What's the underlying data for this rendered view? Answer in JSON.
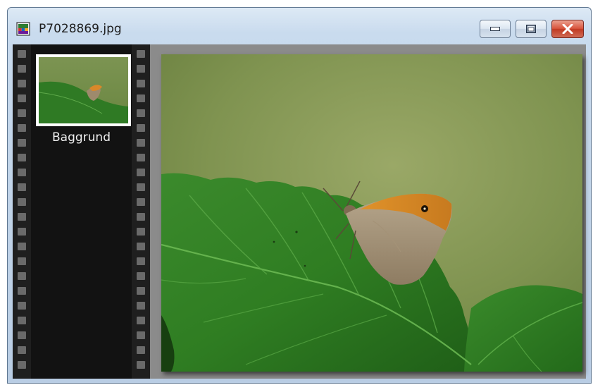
{
  "window": {
    "title": "P7028869.jpg",
    "icon": "image-file-icon"
  },
  "controls": {
    "minimize_icon": "minimize-icon",
    "maximize_icon": "maximize-icon",
    "close_icon": "close-icon",
    "close_color": "#c9452e"
  },
  "filmstrip": {
    "layers": [
      {
        "label": "Baggrund",
        "thumbnail": "butterfly-on-leaf-thumbnail",
        "selected": true
      }
    ]
  },
  "canvas": {
    "image": "photo-butterfly-on-leaf"
  }
}
